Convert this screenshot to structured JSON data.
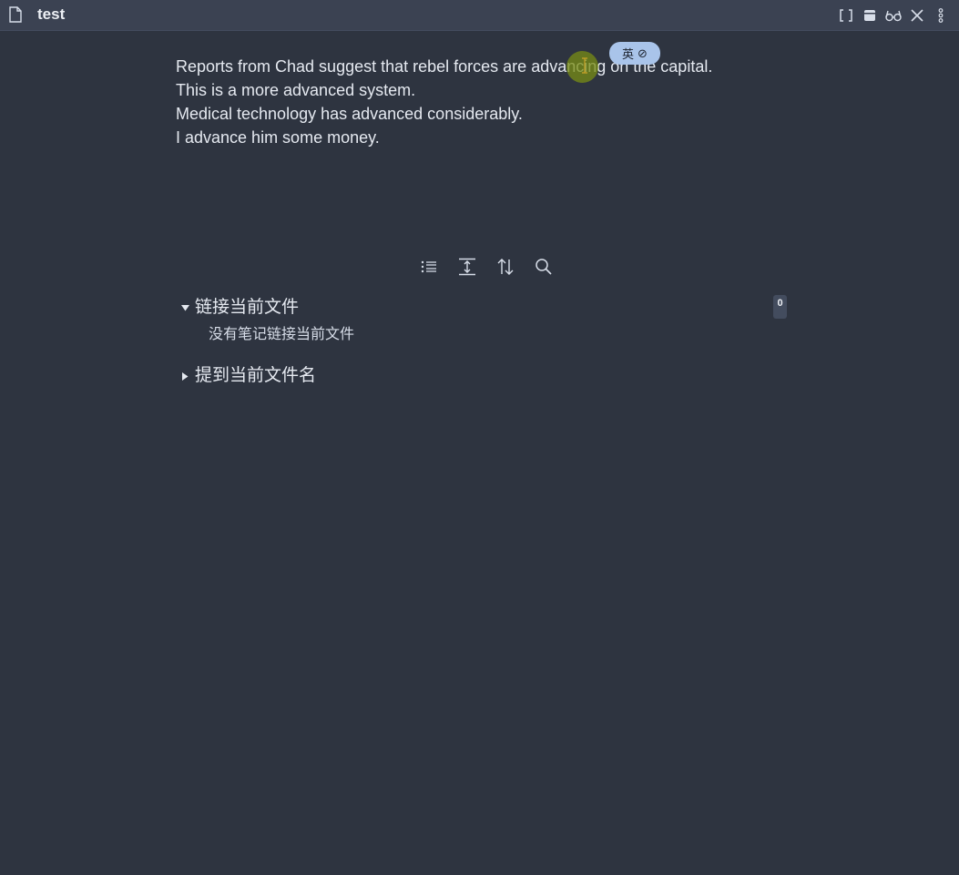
{
  "titlebar": {
    "file_icon": "file-icon",
    "title": "test",
    "actions": [
      {
        "name": "link-brackets-icon"
      },
      {
        "name": "archive-icon"
      },
      {
        "name": "reading-glasses-icon"
      },
      {
        "name": "close-icon"
      },
      {
        "name": "more-options-icon"
      }
    ]
  },
  "editor": {
    "lines": [
      "Reports from Chad suggest that rebel forces are advancing on the capital.",
      "This is a more advanced system.",
      "Medical technology has advanced considerably.",
      "I advance him some money."
    ]
  },
  "ime_badge": {
    "label": "英",
    "status_icon": "⊘"
  },
  "backlinks": {
    "toolbar": [
      {
        "name": "collapse-results-icon"
      },
      {
        "name": "show-more-context-icon"
      },
      {
        "name": "sort-order-icon"
      },
      {
        "name": "search-icon"
      }
    ],
    "linked": {
      "title": "链接当前文件",
      "count": "0",
      "empty_message": "没有笔记链接当前文件",
      "expanded": true
    },
    "unlinked": {
      "title": "提到当前文件名",
      "expanded": false
    }
  },
  "colors": {
    "background": "#2e3440",
    "titlebar": "#3b4252",
    "text": "#e5e9f0",
    "ime_badge": "#a9c4ea",
    "count_badge": "#434c5e"
  }
}
